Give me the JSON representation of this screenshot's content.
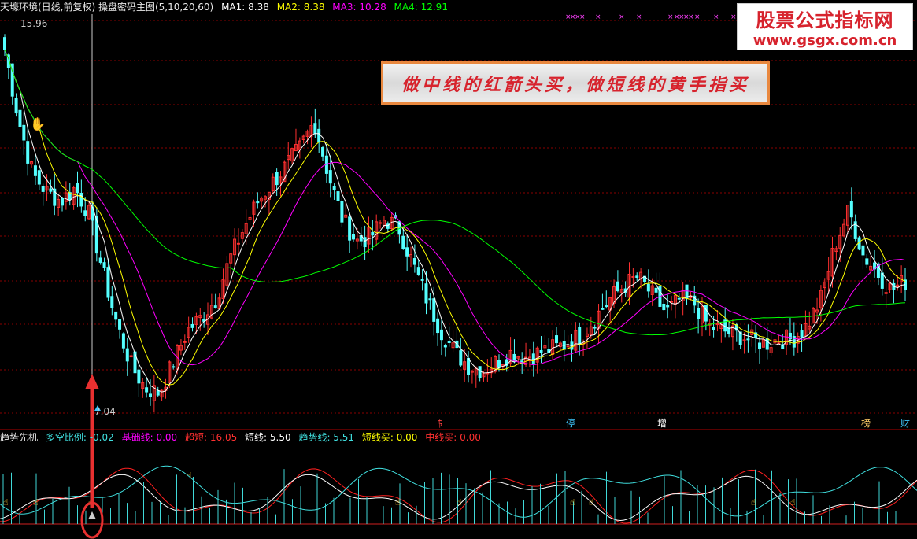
{
  "header": {
    "title": "天壕环境(日线,前复权) 操盘密码主图(5,10,20,60)",
    "ma1": "MA1: 8.38",
    "ma2": "MA2: 8.38",
    "ma3": "MA3: 10.28",
    "ma4": "MA4: 12.91"
  },
  "colors": {
    "ma1": "#ffffff",
    "ma2": "#ffff00",
    "ma3": "#ff00ff",
    "ma4": "#00ff00",
    "up": "#ff3030",
    "down": "#54ffff",
    "grid": "#8a0000",
    "sub_white": "#ffffff",
    "sub_red": "#ff2020",
    "sub_cyan": "#40e0e0"
  },
  "price_labels": {
    "high": "15.96",
    "low": "7.04"
  },
  "banner": {
    "text": "做中线的红箭头买，做短线的黄手指买"
  },
  "logo": {
    "line1": "股票公式指标网",
    "line2": "www.gsgx.com.cn"
  },
  "event_tags": {
    "t1": "$",
    "t2": "停",
    "t3": "增",
    "t4": "榜",
    "t5": "财"
  },
  "sub_header": {
    "name": "趋势先机",
    "duokong": "多空比例: -0.02",
    "jichu": "基础线: 0.00",
    "chaoduan": "超短: 16.05",
    "duanxian": "短线: 5.50",
    "qushi": "趋势线: 5.51",
    "duanxianmai": "短线买: 0.00",
    "zhongxianmai": "中线买: 0.00"
  },
  "chart_data": [
    {
      "type": "candlestick",
      "title": "天壕环境(日线,前复权) 操盘密码主图(5,10,20,60)",
      "ylim": [
        7.04,
        15.96
      ],
      "series": [
        {
          "name": "MA1",
          "value": 8.38
        },
        {
          "name": "MA2",
          "value": 8.38
        },
        {
          "name": "MA3",
          "value": 10.28
        },
        {
          "name": "MA4",
          "value": 12.91
        }
      ],
      "close_trend": [
        15.2,
        13.6,
        12.4,
        12.0,
        11.8,
        12.1,
        11.5,
        10.2,
        9.0,
        8.1,
        7.6,
        7.5,
        8.2,
        8.9,
        9.2,
        9.6,
        10.5,
        11.2,
        11.8,
        12.2,
        12.6,
        13.0,
        13.6,
        12.4,
        11.4,
        10.9,
        11.0,
        11.4,
        11.2,
        10.4,
        9.6,
        8.9,
        8.4,
        8.1,
        8.0,
        8.2,
        8.4,
        8.3,
        8.4,
        8.5,
        8.6,
        8.8,
        9.2,
        9.6,
        9.9,
        10.1,
        9.7,
        9.3,
        9.6,
        9.5,
        9.0,
        8.9,
        8.8,
        8.7,
        8.6,
        8.7,
        8.7,
        9.0,
        9.6,
        10.8,
        11.6,
        10.6,
        10.2,
        9.8,
        10.0
      ]
    },
    {
      "type": "line",
      "title": "趋势先机",
      "series": [
        {
          "name": "多空比例",
          "value": -0.02
        },
        {
          "name": "基础线",
          "value": 0.0
        },
        {
          "name": "超短",
          "value": 16.05
        },
        {
          "name": "短线",
          "value": 5.5
        },
        {
          "name": "趋势线",
          "value": 5.51
        },
        {
          "name": "短线买",
          "value": 0.0
        },
        {
          "name": "中线买",
          "value": 0.0
        }
      ]
    }
  ]
}
